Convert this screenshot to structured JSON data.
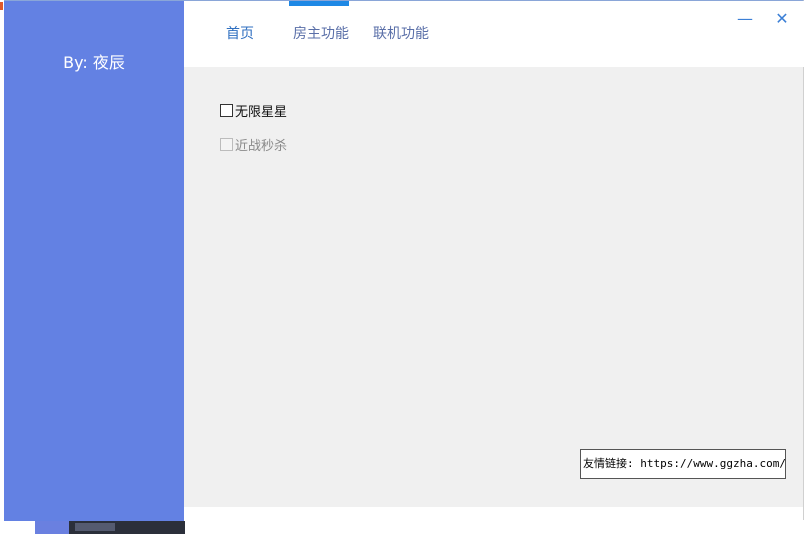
{
  "sidebar": {
    "author": "By: 夜辰"
  },
  "tabs": [
    {
      "label": "首页",
      "active": true
    },
    {
      "label": "房主功能",
      "active": false
    },
    {
      "label": "联机功能",
      "active": false
    }
  ],
  "window_controls": {
    "minimize": "—",
    "close": "✕"
  },
  "options": [
    {
      "label": "无限星星",
      "checked": false,
      "enabled": true
    },
    {
      "label": "近战秒杀",
      "checked": false,
      "enabled": false
    }
  ],
  "link_box": {
    "text": "友情链接: https://www.ggzha.com/"
  },
  "colors": {
    "sidebar": "#6381e3",
    "tab_indicator": "#1e88e5",
    "content_bg": "#f0f0f0"
  }
}
